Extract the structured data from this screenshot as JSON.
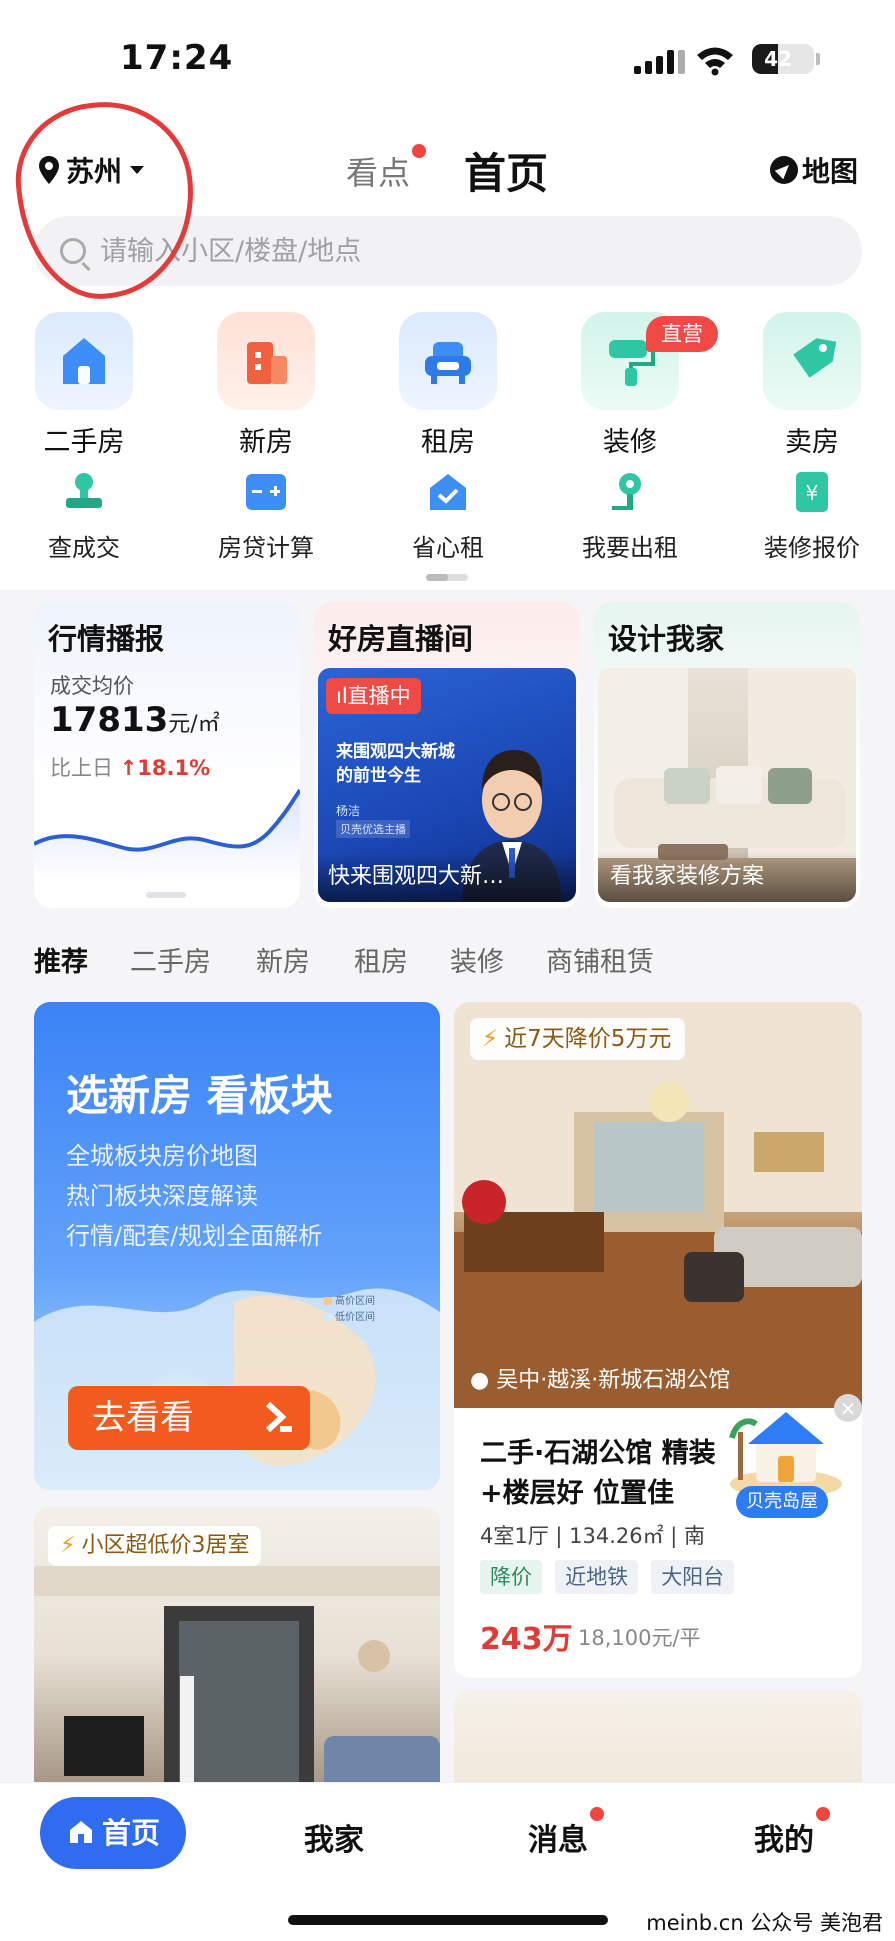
{
  "status_bar": {
    "time": "17:24",
    "battery": "42",
    "battery_level": 0.42
  },
  "header": {
    "city": "苏州",
    "tab_kandian": "看点",
    "tab_home": "首页",
    "map_label": "地图"
  },
  "search": {
    "placeholder": "请输入小区/楼盘/地点"
  },
  "main_icons": [
    {
      "label": "二手房",
      "icon": "house-icon",
      "color": "#3d8ef6"
    },
    {
      "label": "新房",
      "icon": "building-icon",
      "color": "#f2613f"
    },
    {
      "label": "租房",
      "icon": "sofa-icon",
      "color": "#3d8ef6"
    },
    {
      "label": "装修",
      "icon": "paint-roller-icon",
      "color": "#2fc6a3",
      "badge": "直营"
    },
    {
      "label": "卖房",
      "icon": "price-tag-icon",
      "color": "#2fc6a3"
    }
  ],
  "secondary_icons": [
    {
      "label": "查成交",
      "icon": "stamp-icon"
    },
    {
      "label": "房贷计算",
      "icon": "calculator-icon"
    },
    {
      "label": "省心租",
      "icon": "check-house-icon"
    },
    {
      "label": "我要出租",
      "icon": "key-icon"
    },
    {
      "label": "装修报价",
      "icon": "quote-icon"
    }
  ],
  "cards": {
    "market": {
      "title": "行情播报",
      "avg_label": "成交均价",
      "avg_price": "17813",
      "unit": "元/㎡",
      "compare_label": "比上日",
      "change": "18.1%"
    },
    "live": {
      "title": "好房直播间",
      "live_tag": "直播中",
      "headline": "来围观四大新城的前世今生",
      "host": "杨洁",
      "org": "贝壳优选主播",
      "caption": "快来围观四大新…"
    },
    "design": {
      "title": "设计我家",
      "caption": "看我家装修方案"
    }
  },
  "categories": [
    "推荐",
    "二手房",
    "新房",
    "租房",
    "装修",
    "商铺租赁"
  ],
  "feed": {
    "ad": {
      "headline": "选新房 看板块",
      "lines": [
        "全城板块房价地图",
        "热门板块深度解读",
        "行情/配套/规划全面解析"
      ],
      "legend_high": "高价区间",
      "legend_low": "低价区间",
      "cta": "去看看"
    },
    "listing": {
      "promo": "近7天降价5万元",
      "location": "吴中·越溪·新城石湖公馆",
      "title": "二手·石湖公馆 精装+楼层好 位置佳",
      "spec": "4室1厅 | 134.26㎡ | 南",
      "tags": [
        "降价",
        "近地铁",
        "大阳台"
      ],
      "price": "243万",
      "unit_price": "18,100元/平"
    },
    "listing2": {
      "promo": "小区超低价3居室"
    },
    "island": {
      "label": "贝壳岛屋"
    }
  },
  "bottom_nav": {
    "home": "首页",
    "myhome": "我家",
    "messages": "消息",
    "mine": "我的"
  },
  "watermark": "meinb.cn  公众号 美泡君"
}
